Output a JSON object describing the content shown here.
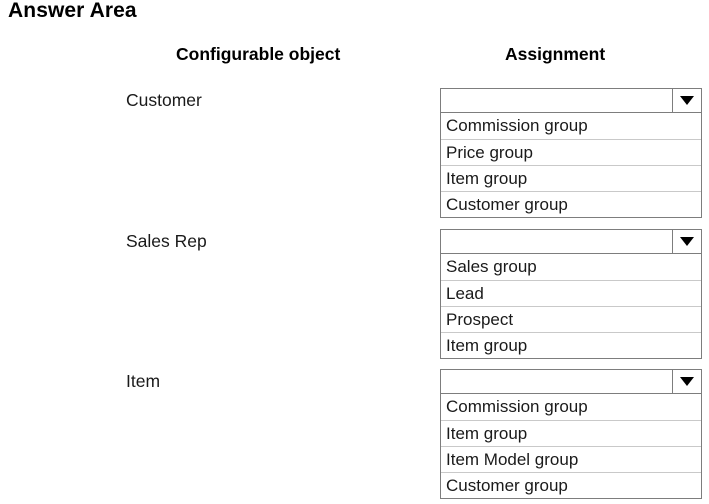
{
  "page": {
    "title": "Answer Area"
  },
  "headers": {
    "configurable_object": "Configurable object",
    "assignment": "Assignment"
  },
  "colors": {
    "border": "#7d7d7d",
    "option_separator": "#c9c9c9",
    "arrow": "#000000",
    "background": "#ffffff",
    "text": "#1a1a1a"
  },
  "rows": [
    {
      "label": "Customer",
      "dropdown": {
        "selected_value": "",
        "placeholder": "",
        "arrow_icon": "chevron-down-icon",
        "expanded": true,
        "options": [
          "Commission group",
          "Price group",
          "Item group",
          "Customer group"
        ]
      }
    },
    {
      "label": "Sales Rep",
      "dropdown": {
        "selected_value": "",
        "placeholder": "",
        "arrow_icon": "chevron-down-icon",
        "expanded": true,
        "options": [
          "Sales group",
          "Lead",
          "Prospect",
          "Item group"
        ]
      }
    },
    {
      "label": "Item",
      "dropdown": {
        "selected_value": "",
        "placeholder": "",
        "arrow_icon": "chevron-down-icon",
        "expanded": true,
        "options": [
          "Commission group",
          "Item group",
          "Item Model group",
          "Customer group"
        ]
      }
    }
  ]
}
